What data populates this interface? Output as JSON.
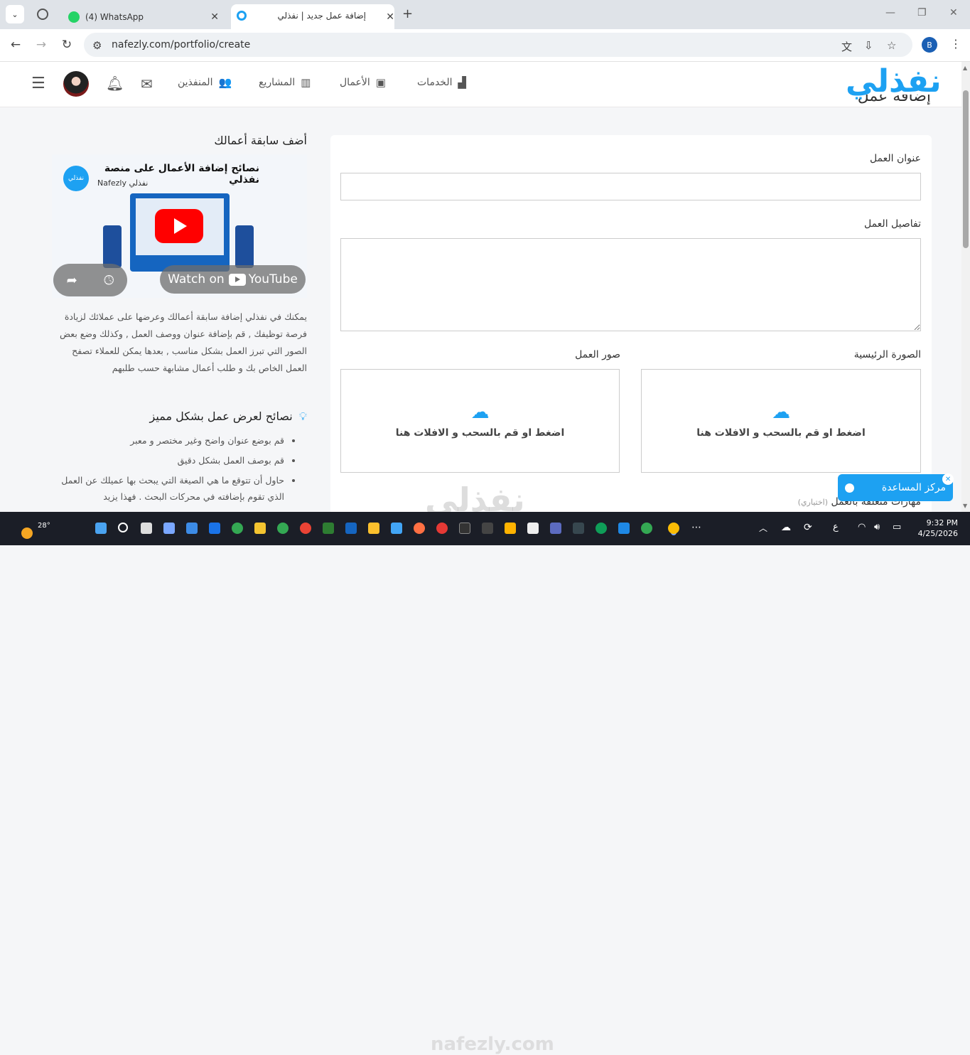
{
  "browser": {
    "tabs": [
      {
        "title": "(4) WhatsApp",
        "favicon": "whatsapp-icon",
        "color": "#25d366"
      },
      {
        "title": "إضافة عمل جديد | نفذلي",
        "favicon": "nafezly-icon",
        "color": "#1da1f2"
      }
    ],
    "url": "nafezly.com/portfolio/create",
    "profile_initial": "B"
  },
  "site": {
    "logo": "نفذلي",
    "nav": {
      "services": "الخدمات",
      "works": "الأعمال",
      "projects": "المشاريع",
      "freelancers": "المنفذين"
    },
    "page_title": "إضافة عمل"
  },
  "form": {
    "title_label": "عنوان العمل",
    "title_value": "",
    "details_label": "تفاصيل العمل",
    "details_value": "",
    "main_image_label": "الصورة الرئيسية",
    "work_images_label": "صور العمل",
    "drop_text": "اضغط او قم بالسحب و الافلات هنا",
    "skills_label": "مهارات متعلقة بالعمل",
    "skills_optional": "(اختياري)"
  },
  "sidebar": {
    "title": "أضف سابقة أعمالك",
    "video": {
      "title": "نصائح إضافة الأعمال على منصة نفذلي",
      "channel": "Nafezly نفذلي",
      "channel_logo": "نفذلي",
      "watch_on": "Watch on",
      "youtube": "YouTube"
    },
    "description": "يمكنك في نفذلي إضافة سابقة أعمالك وعرضها على عملائك لزيادة فرصة توظيفك , قم بإضافة عنوان ووصف العمل , وكذلك وضع بعض الصور التي تبرز العمل بشكل مناسب , بعدها يمكن للعملاء تصفح العمل الخاص بك و طلب أعمال مشابهة حسب طلبهم",
    "tips_title": "نصائح لعرض عمل بشكل مميز",
    "tips": [
      "قم بوضع عنوان واضح وغير مختصر و معبر",
      "قم بوصف العمل بشكل دقيق",
      "حاول أن تتوقع ما هي الصيغة التي يبحث بها عميلك عن العمل الذي تقوم بإضافته في محركات البحث . فهذا يزيد"
    ]
  },
  "help": {
    "label": "مركز المساعدة"
  },
  "watermark": {
    "logo": "نفذلي",
    "domain": "nafezly.com"
  },
  "taskbar": {
    "temperature": "28°",
    "time": "9:32 PM",
    "date": "4/25/2026",
    "lang": "ع"
  },
  "colors": {
    "brand": "#1da1f2",
    "taskbar": "#1b1e27"
  }
}
